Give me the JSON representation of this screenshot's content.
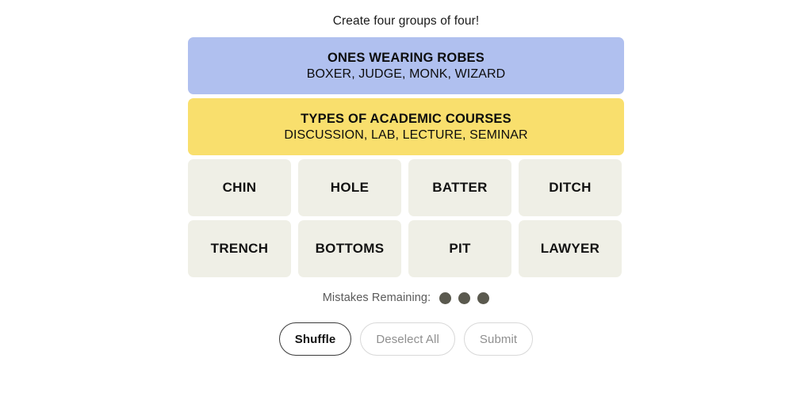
{
  "page": {
    "background_color": "#ffffff",
    "prompt": "Create four groups of four!"
  },
  "solved_groups": [
    {
      "title": "ONES WEARING ROBES",
      "members": "BOXER, JUDGE, MONK, WIZARD",
      "color": "#b0c0ef",
      "difficulty": "purple"
    },
    {
      "title": "TYPES OF ACADEMIC COURSES",
      "members": "DISCUSSION, LAB, LECTURE, SEMINAR",
      "color": "#f9df6d",
      "difficulty": "yellow"
    }
  ],
  "grid": {
    "tile_color": "#efefe6",
    "rows": [
      [
        "CHIN",
        "HOLE",
        "BATTER",
        "DITCH"
      ],
      [
        "TRENCH",
        "BOTTOMS",
        "PIT",
        "LAWYER"
      ]
    ]
  },
  "mistakes": {
    "label": "Mistakes Remaining:",
    "remaining": 3,
    "dot_color": "#5a594e"
  },
  "controls": [
    {
      "label": "Shuffle",
      "state": "enabled"
    },
    {
      "label": "Deselect All",
      "state": "disabled"
    },
    {
      "label": "Submit",
      "state": "disabled"
    }
  ]
}
